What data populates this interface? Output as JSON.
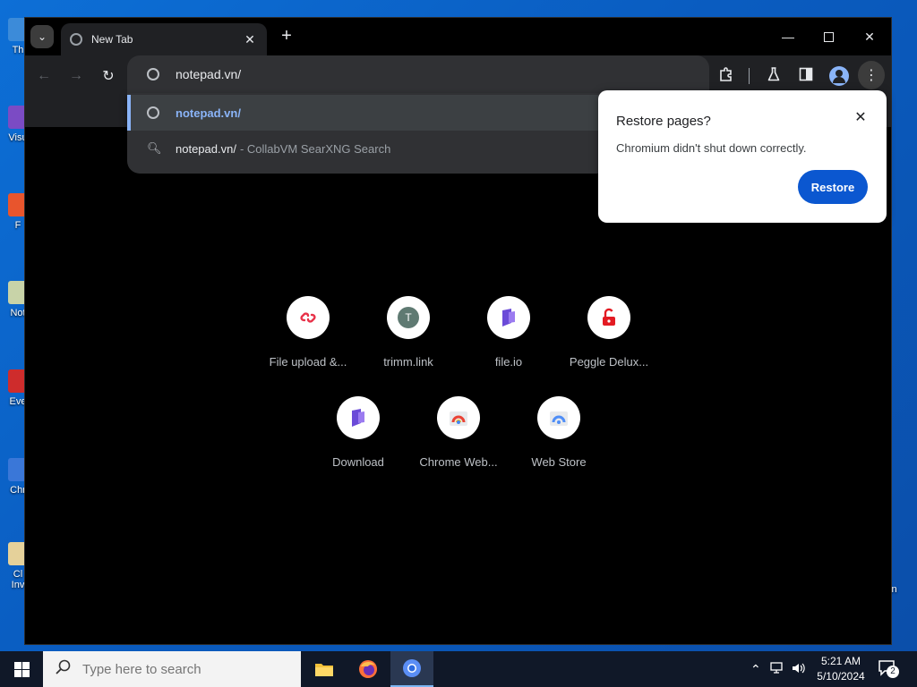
{
  "desktop": {
    "icons": [
      {
        "label": "Th",
        "color": "#3c8bd9"
      },
      {
        "label": "Visu",
        "color": "#7b4bc4"
      },
      {
        "label": "F",
        "color": "#e8552d"
      },
      {
        "label": "Not",
        "color": "#c8d3a8"
      },
      {
        "label": "Eve",
        "color": "#ce2c2c"
      },
      {
        "label": "Chr",
        "color": "#3a77d8"
      },
      {
        "label": "Cl",
        "color": "#e5d19a"
      },
      {
        "label": "Inv",
        "color": "#e5d19a"
      }
    ],
    "right_label": "in"
  },
  "browser": {
    "tab": {
      "title": "New Tab"
    },
    "omnibox": {
      "value": "notepad.vn/"
    },
    "suggestions": [
      {
        "text": "notepad.vn/",
        "type": "url"
      },
      {
        "text": "notepad.vn/",
        "sub": "- CollabVM SearXNG Search",
        "type": "search"
      }
    ],
    "restore_bubble": {
      "title": "Restore pages?",
      "message": "Chromium didn't shut down correctly.",
      "button": "Restore",
      "button_color": "#0b57d0"
    },
    "shortcuts": [
      {
        "label": "File upload &...",
        "icon": "link-icon",
        "color": "#e8334a"
      },
      {
        "label": "trimm.link",
        "icon": "letter-t-icon",
        "letter": "T",
        "color": "#5f7a72"
      },
      {
        "label": "file.io",
        "icon": "fileio-logo-icon",
        "color": "#6b4bd8"
      },
      {
        "label": "Peggle Delux...",
        "icon": "unlock-icon",
        "color": "#e31b23"
      },
      {
        "label": "Download",
        "icon": "fileio-logo-icon",
        "color": "#6b4bd8"
      },
      {
        "label": "Chrome Web...",
        "icon": "chrome-web-store-icon",
        "color": "#34a853"
      },
      {
        "label": "Web Store",
        "icon": "web-store-icon",
        "color": "#4f8ef7"
      }
    ]
  },
  "taskbar": {
    "search_placeholder": "Type here to search",
    "time": "5:21 AM",
    "date": "5/10/2024",
    "notification_count": "2"
  }
}
